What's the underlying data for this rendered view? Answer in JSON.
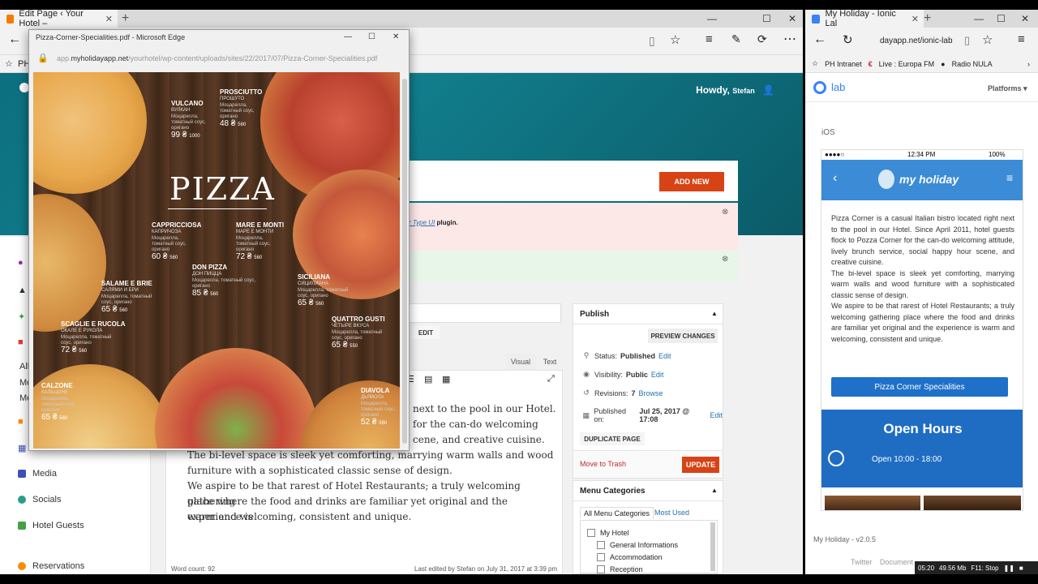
{
  "left_browser": {
    "tab_title": "Edit Page ‹ Your Hotel –",
    "favorites_initial": "PH",
    "howdy_label": "Howdy,",
    "howdy_user": "Stefan",
    "add_new": "ADD NEW",
    "notice_link": "r Type UI",
    "notice_suffix": "plugin.",
    "edit_slug": "EDIT",
    "tab_visual": "Visual",
    "tab_text": "Text",
    "editor_lines": [
      "next to the pool in our Hotel.",
      "for the can-do welcoming",
      "cene, and creative cuisine.",
      "The bi-level space is sleek yet comforting, marrying warm walls and wood",
      "furniture with a sophisticated classic sense of design.",
      "We aspire to be that rarest of Hotel Restaurants; a truly welcoming gathering",
      "place where the food and drinks are familiar yet original and the experience is",
      "warm and welcoming, consistent and unique."
    ],
    "word_count": "Word count: 92",
    "last_edited": "Last edited by Stefan on July 31, 2017 at 3:39 pm",
    "sidebar": [
      {
        "label": "Media",
        "color": "#3f51b5"
      },
      {
        "label": "Socials",
        "color": "#2a9d8f"
      },
      {
        "label": "Hotel Guests",
        "color": "#43a047"
      },
      {
        "label": "Reservations",
        "color": "#fb8c00"
      }
    ],
    "sidebar_partial": [
      "All",
      "Me",
      "Me"
    ],
    "publish": {
      "title": "Publish",
      "preview": "PREVIEW CHANGES",
      "status_label": "Status:",
      "status_value": "Published",
      "visibility_label": "Visibility:",
      "visibility_value": "Public",
      "revisions_label": "Revisions:",
      "revisions_value": "7",
      "revisions_link": "Browse",
      "published_label": "Published on:",
      "published_value": "Jul 25, 2017 @ 17:08",
      "edit": "Edit",
      "duplicate": "DUPLICATE PAGE",
      "trash": "Move to Trash",
      "update": "UPDATE"
    },
    "menu_categories": {
      "title": "Menu Categories",
      "tab_all": "All Menu Categories",
      "tab_used": "Most Used",
      "items": [
        "My Hotel",
        "General Informations",
        "Accommodation",
        "Reception"
      ]
    }
  },
  "pdf_window": {
    "title": "Pizza-Corner-Specialities.pdf - Microsoft Edge",
    "url_prefix": "app.",
    "url_domain": "myholidayapp.net",
    "url_path": "/yourhotel/wp-content/uploads/sites/22/2017/07/Pizza-Corner-Specialities.pdf",
    "heading": "PIZZA",
    "pizzas": [
      {
        "name": "VULCANO",
        "sub": "ВУЛКАН",
        "price": "99 ₴",
        "small": "1000"
      },
      {
        "name": "PROSCIUTTO",
        "sub": "ПРОШУТО",
        "price": "48 ₴",
        "small": "560"
      },
      {
        "name": "CAPPRICCIOSA",
        "sub": "КАПРИЧОЗА",
        "price": "60 ₴",
        "small": "560"
      },
      {
        "name": "MARE E MONTI",
        "sub": "МАРЕ Е МОНТИ",
        "price": "72 ₴",
        "small": "560"
      },
      {
        "name": "DON PIZZA",
        "sub": "ДОН ПИЦЦА",
        "price": "85 ₴",
        "small": "560"
      },
      {
        "name": "SALAME E BRIE",
        "sub": "САЛЯМИ И БРИ",
        "price": "65 ₴",
        "small": "560"
      },
      {
        "name": "SICILIANA",
        "sub": "СИЦИЛИАНА",
        "price": "65 ₴",
        "small": "560"
      },
      {
        "name": "SCAGLIE E RUCOLA",
        "sub": "ОКАЛЕ Е РУКОЛА",
        "price": "72 ₴",
        "small": "560"
      },
      {
        "name": "QUATTRO GUSTI",
        "sub": "ЧЕТЫРЕ ВКУСА",
        "price": "65 ₴",
        "small": "550"
      },
      {
        "name": "CALZONE",
        "sub": "КАЛЬЦОНЕ",
        "price": "65 ₴",
        "small": "560"
      },
      {
        "name": "DIAVOLA",
        "sub": "ДЬЯВОЛА",
        "price": "52 ₴",
        "small": "560"
      }
    ],
    "desc": "Моцарелла, томатный соус, оригано"
  },
  "right_browser": {
    "tab_title": "My Holiday - Ionic Lal",
    "url": "dayapp.net/ionic-lab",
    "favorites": [
      "PH Intranet",
      "Live : Europa FM",
      "Radio NULA"
    ],
    "lab_label": "lab",
    "platforms": "Platforms",
    "ios_label": "iOS",
    "phone_time": "12:34 PM",
    "phone_battery": "100%",
    "app_name": "my holiday",
    "description": "Pizza Corner is a casual Italian bistro located right next to the pool in our Hotel. Since April 2011, hotel guests flock to Pozza Corner for the can-do welcoming attitude, lively brunch service, social happy hour scene, and creative cuisine.",
    "description2": "The bi-level space is sleek yet comforting, marrying warm walls and wood furniture with a sophisticated classic sense of design.",
    "description3": "We aspire to be that rarest of Hotel Restaurants; a truly welcoming gathering place where the food and drinks are familiar yet original and the experience is warm and welcoming, consistent and unique.",
    "button": "Pizza Corner Specialities",
    "open_hours_title": "Open Hours",
    "open_hours_value": "Open 10:00 - 18:00",
    "version": "My Holiday - v2.0.5",
    "footer_links": [
      "Twitter",
      "Document"
    ]
  },
  "recorder": {
    "time": "05:20",
    "size": "49.56 Mb",
    "hint": "F11: Stop"
  },
  "colors": {
    "wp_teal": "#12808f",
    "accent_red": "#d84315",
    "app_blue": "#1f6dc3"
  }
}
